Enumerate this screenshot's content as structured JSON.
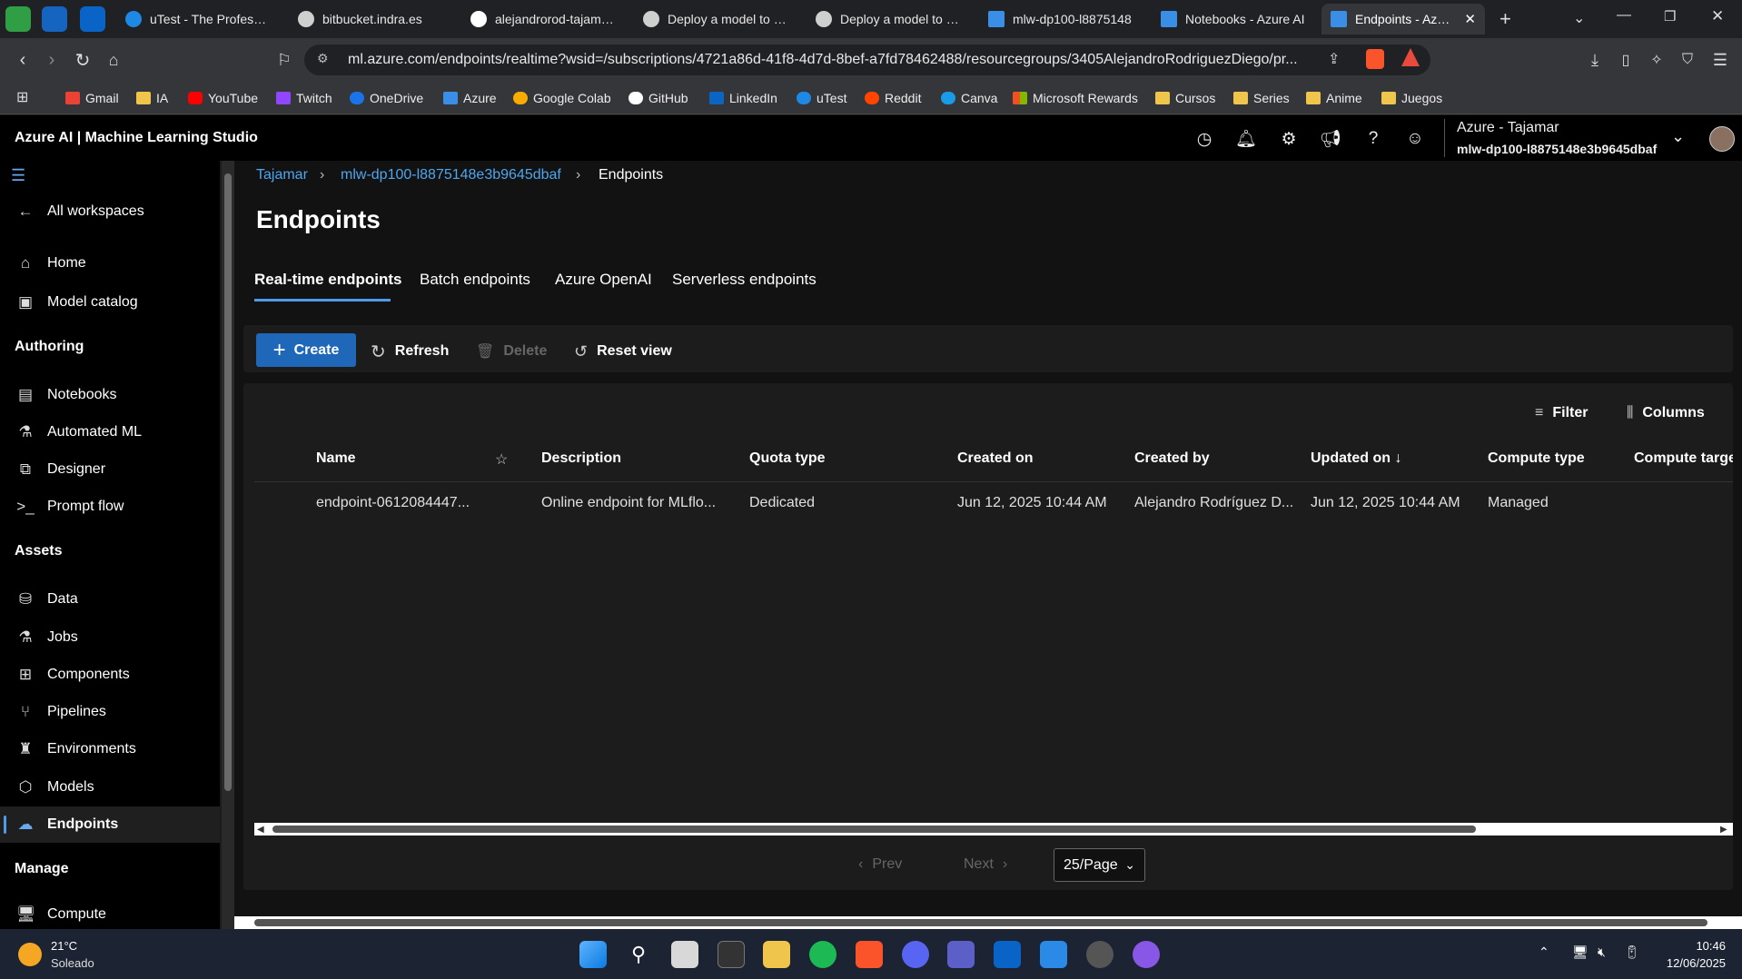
{
  "browser": {
    "tabs": [
      {
        "label": "uTest - The Profession",
        "color": "#1e88e5",
        "letter": "U"
      },
      {
        "label": "bitbucket.indra.es",
        "color": "#cfcfcf",
        "letter": ""
      },
      {
        "label": "alejandrorod-tajamar/",
        "color": "#ffffff",
        "letter": ""
      },
      {
        "label": "Deploy a model to a r",
        "color": "#cfcfcf",
        "letter": ""
      },
      {
        "label": "Deploy a model to a b",
        "color": "#cfcfcf",
        "letter": ""
      },
      {
        "label": "mlw-dp100-l8875148",
        "color": "#3a8ee6",
        "letter": ""
      },
      {
        "label": "Notebooks - Azure AI",
        "color": "#3a8ee6",
        "letter": ""
      },
      {
        "label": "Endpoints - Azure",
        "color": "#3a8ee6",
        "letter": ""
      }
    ],
    "url": "ml.azure.com/endpoints/realtime?wsid=/subscriptions/4721a86d-41f8-4d7d-8bef-a7fd78462488/resourcegroups/3405AlejandroRodriguezDiego/pr...",
    "bookmarks": [
      {
        "label": "Gmail",
        "color": "#ea4335"
      },
      {
        "label": "IA",
        "color": "#f0c54b"
      },
      {
        "label": "YouTube",
        "color": "#ff0000"
      },
      {
        "label": "Twitch",
        "color": "#9146ff"
      },
      {
        "label": "OneDrive",
        "color": "#1a73e8"
      },
      {
        "label": "Azure",
        "color": "#3a8ee6"
      },
      {
        "label": "Google Colab",
        "color": "#f9ab00"
      },
      {
        "label": "GitHub",
        "color": "#ffffff"
      },
      {
        "label": "LinkedIn",
        "color": "#0a66c2"
      },
      {
        "label": "uTest",
        "color": "#1e88e5"
      },
      {
        "label": "Reddit",
        "color": "#ff4500"
      },
      {
        "label": "Canva",
        "color": "#1a9be8"
      },
      {
        "label": "Microsoft Rewards",
        "color": "#7fba00"
      },
      {
        "label": "Cursos",
        "color": "#f0c54b"
      },
      {
        "label": "Series",
        "color": "#f0c54b"
      },
      {
        "label": "Anime",
        "color": "#f0c54b"
      },
      {
        "label": "Juegos",
        "color": "#f0c54b"
      }
    ]
  },
  "app": {
    "title": "Azure AI | Machine Learning Studio",
    "account_name": "Azure - Tajamar",
    "workspace": "mlw-dp100-l8875148e3b9645dbaf"
  },
  "sidebar": {
    "all_workspaces": "All workspaces",
    "home": "Home",
    "model_catalog": "Model catalog",
    "authoring": "Authoring",
    "notebooks": "Notebooks",
    "automated_ml": "Automated ML",
    "designer": "Designer",
    "prompt_flow": "Prompt flow",
    "assets": "Assets",
    "data": "Data",
    "jobs": "Jobs",
    "components": "Components",
    "pipelines": "Pipelines",
    "environments": "Environments",
    "models": "Models",
    "endpoints": "Endpoints",
    "manage": "Manage",
    "compute": "Compute"
  },
  "breadcrumb": {
    "root": "Tajamar",
    "workspace": "mlw-dp100-l8875148e3b9645dbaf",
    "current": "Endpoints"
  },
  "page": {
    "title": "Endpoints",
    "tabs": [
      "Real-time endpoints",
      "Batch endpoints",
      "Azure OpenAI",
      "Serverless endpoints"
    ]
  },
  "toolbar": {
    "create": "Create",
    "refresh": "Refresh",
    "delete": "Delete",
    "reset_view": "Reset view"
  },
  "grid": {
    "filter": "Filter",
    "columns_btn": "Columns",
    "headers": {
      "name": "Name",
      "description": "Description",
      "quota_type": "Quota type",
      "created_on": "Created on",
      "created_by": "Created by",
      "updated_on": "Updated on ↓",
      "compute_type": "Compute type",
      "compute_target": "Compute target"
    },
    "rows": [
      {
        "name": "endpoint-0612084447...",
        "description": "Online endpoint for MLflo...",
        "quota_type": "Dedicated",
        "created_on": "Jun 12, 2025 10:44 AM",
        "created_by": "Alejandro Rodríguez D...",
        "updated_on": "Jun 12, 2025 10:44 AM",
        "compute_type": "Managed"
      }
    ]
  },
  "pagination": {
    "prev": "Prev",
    "next": "Next",
    "page_size": "25/Page"
  },
  "taskbar": {
    "temperature": "21°C",
    "weather": "Soleado",
    "time": "10:46",
    "date": "12/06/2025"
  }
}
